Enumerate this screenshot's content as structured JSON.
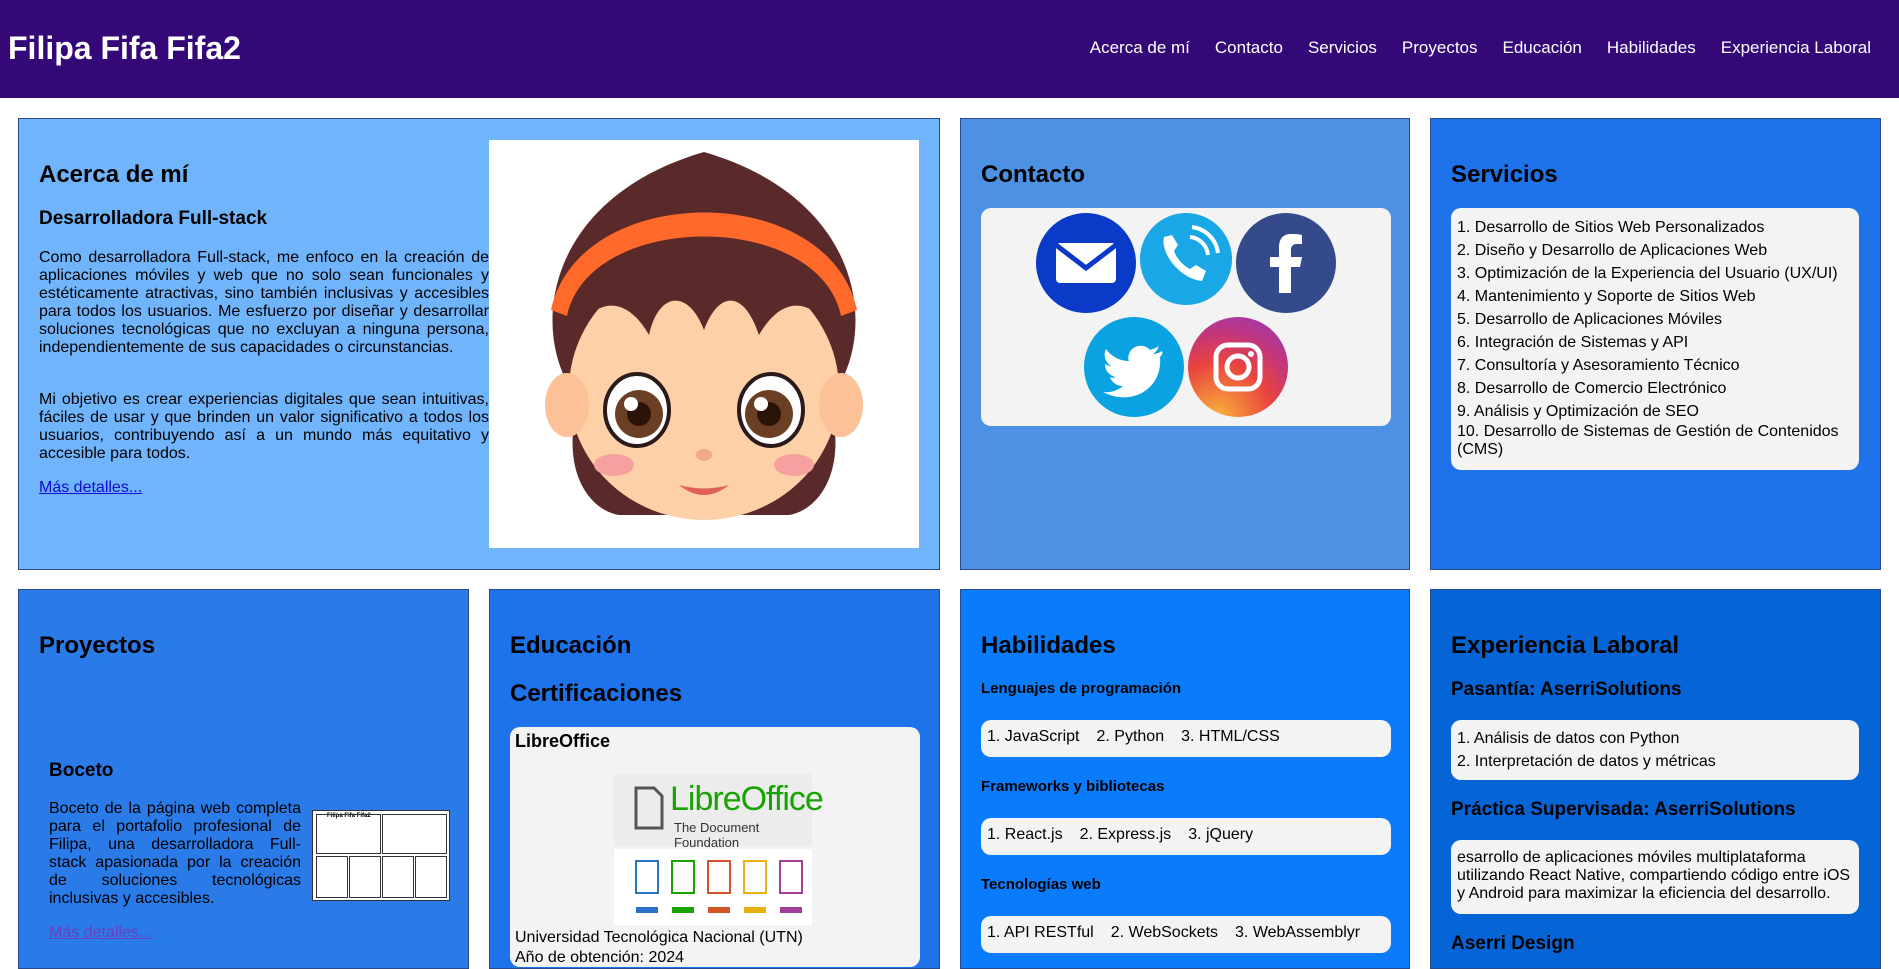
{
  "header": {
    "title": "Filipa Fifa Fifa2",
    "nav": [
      "Acerca de mí",
      "Contacto",
      "Servicios",
      "Proyectos",
      "Educación",
      "Habilidades",
      "Experiencia Laboral"
    ]
  },
  "about": {
    "title": "Acerca de mí",
    "subtitle": "Desarrolladora Full-stack",
    "p1": "Como desarrolladora Full-stack, me enfoco en la creación de aplicaciones móviles y web que no solo sean funcionales y estéticamente atractivas, sino también inclusivas y accesibles para todos los usuarios. Me esfuerzo por diseñar y desarrollar soluciones tecnológicas que no excluyan a ninguna persona, independientemente de sus capacidades o circunstancias.",
    "p2": "Mi objetivo es crear experiencias digitales que sean intuitivas, fáciles de usar y que brinden un valor significativo a todos los usuarios, contribuyendo así a un mundo más equitativo y accesible para todos.",
    "more": "Más detalles..."
  },
  "contact": {
    "title": "Contacto",
    "icons": [
      "email-icon",
      "phone-icon",
      "facebook-icon",
      "twitter-icon",
      "instagram-icon"
    ]
  },
  "services": {
    "title": "Servicios",
    "items": [
      "1. Desarrollo de Sitios Web Personalizados",
      "2. Diseño y Desarrollo de Aplicaciones Web",
      "3. Optimización de la Experiencia del Usuario (UX/UI)",
      "4. Mantenimiento y Soporte de Sitios Web",
      "5. Desarrollo de Aplicaciones Móviles",
      "6. Integración de Sistemas y API",
      "7. Consultoría y Asesoramiento Técnico",
      "8. Desarrollo de Comercio Electrónico",
      "9. Análisis y Optimización de SEO",
      "10. Desarrollo de Sistemas de Gestión de Contenidos (CMS)"
    ]
  },
  "projects": {
    "title": "Proyectos",
    "item_title": "Boceto",
    "item_desc": "Boceto de la página web completa para el portafolio profesional de Filipa, una desarrolladora Full-stack apasionada por la creación de soluciones tecnológicas inclusivas y accesibles.",
    "more": "Más detalles...",
    "thumb_title": "Filipa Fifa Fifa2"
  },
  "education": {
    "title": "Educación",
    "subtitle": "Certificaciones",
    "cert_title": "LibreOffice",
    "logo_main": "LibreOffice",
    "logo_sub": "The Document Foundation",
    "institution": "Universidad Tecnológica Nacional (UTN)",
    "year": "Año de obtención: 2024"
  },
  "skills": {
    "title": "Habilidades",
    "groups": [
      {
        "label": "Lenguajes de programación",
        "items": [
          "1. JavaScript",
          "2. Python",
          "3. HTML/CSS"
        ]
      },
      {
        "label": "Frameworks y bibliotecas",
        "items": [
          "1. React.js",
          "2. Express.js",
          "3. jQuery"
        ]
      },
      {
        "label": "Tecnologías web",
        "items": [
          "1. API RESTful",
          "2. WebSockets",
          "3. WebAssemblyr"
        ]
      }
    ]
  },
  "experience": {
    "title": "Experiencia Laboral",
    "job1": "Pasantía: AserriSolutions",
    "job1_items": [
      "1. Análisis de datos con Python",
      "2. Interpretación de datos y métricas"
    ],
    "job2": "Práctica Supervisada: AserriSolutions",
    "job2_desc": "esarrollo de aplicaciones móviles multiplataforma utilizando React Native, compartiendo código entre iOS y Android para maximizar la eficiencia del desarrollo.",
    "job3": "Aserri Design"
  },
  "colors": {
    "header": "#350878",
    "about": "#70b4fc",
    "contact": "#4c91e3",
    "services": "#1e72ea",
    "projects": "#2a7ae8",
    "education": "#1e72ea",
    "skills": "#0a7bfa",
    "experience": "#0565d6"
  }
}
